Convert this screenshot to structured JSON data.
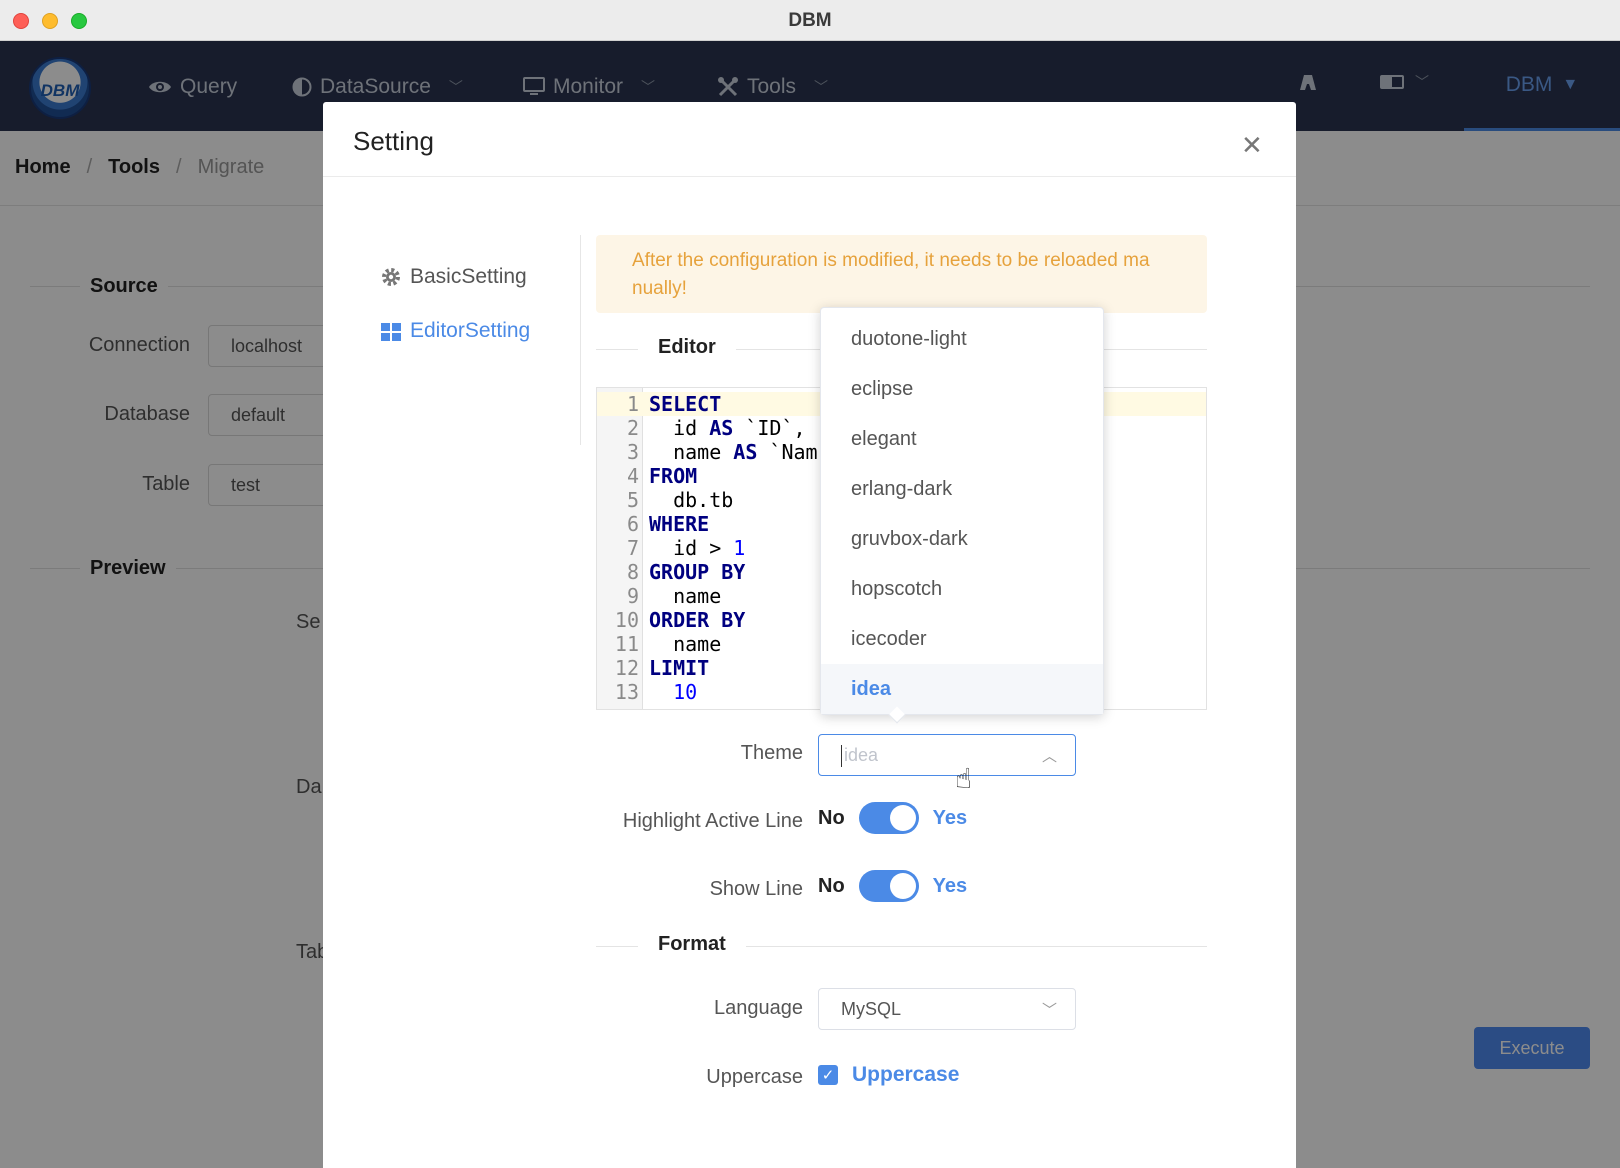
{
  "window": {
    "title": "DBM"
  },
  "header": {
    "logo_text": "DBM",
    "nav": [
      {
        "label": "Query",
        "icon": "eye-icon"
      },
      {
        "label": "DataSource",
        "icon": "half-circle-icon"
      },
      {
        "label": "Monitor",
        "icon": "monitor-icon"
      },
      {
        "label": "Tools",
        "icon": "tools-icon"
      }
    ],
    "user_label": "DBM"
  },
  "breadcrumb": {
    "home": "Home",
    "tools": "Tools",
    "current": "Migrate",
    "separator": "/"
  },
  "page": {
    "source_title": "Source",
    "connection_label": "Connection",
    "connection_value": "localhost",
    "database_label": "Database",
    "database_value": "default",
    "table_label": "Table",
    "table_value": "test",
    "preview_title": "Preview",
    "partial_labels": [
      "Se",
      "Da",
      "Tab"
    ],
    "execute_label": "Execute"
  },
  "modal": {
    "title": "Setting",
    "close_glyph": "✕",
    "menu": [
      {
        "label": "BasicSetting",
        "icon": "gear-icon",
        "active": false
      },
      {
        "label": "EditorSetting",
        "icon": "grid-icon",
        "active": true
      }
    ],
    "notice": "After the configuration is modified, it needs to be reloaded ma nually!",
    "editor_section": "Editor",
    "code_lines": [
      "SELECT",
      "  id AS `ID`,",
      "  name AS `Nam",
      "FROM",
      "  db.tb",
      "WHERE",
      "  id > 1",
      "GROUP BY",
      "  name",
      "ORDER BY",
      "  name",
      "LIMIT",
      "  10"
    ],
    "theme_label": "Theme",
    "theme_placeholder": "idea",
    "theme_options": [
      "duotone-light",
      "eclipse",
      "elegant",
      "erlang-dark",
      "gruvbox-dark",
      "hopscotch",
      "icecoder",
      "idea"
    ],
    "theme_selected": "idea",
    "highlight_label": "Highlight Active Line",
    "show_line_label": "Show Line",
    "switch_no": "No",
    "switch_yes": "Yes",
    "format_section": "Format",
    "language_label": "Language",
    "language_value": "MySQL",
    "uppercase_label": "Uppercase",
    "uppercase_checkbox": "Uppercase"
  },
  "colors": {
    "accent": "#4b8ae6",
    "header_bg": "#2a3450",
    "notice_text": "#e6a23c"
  }
}
